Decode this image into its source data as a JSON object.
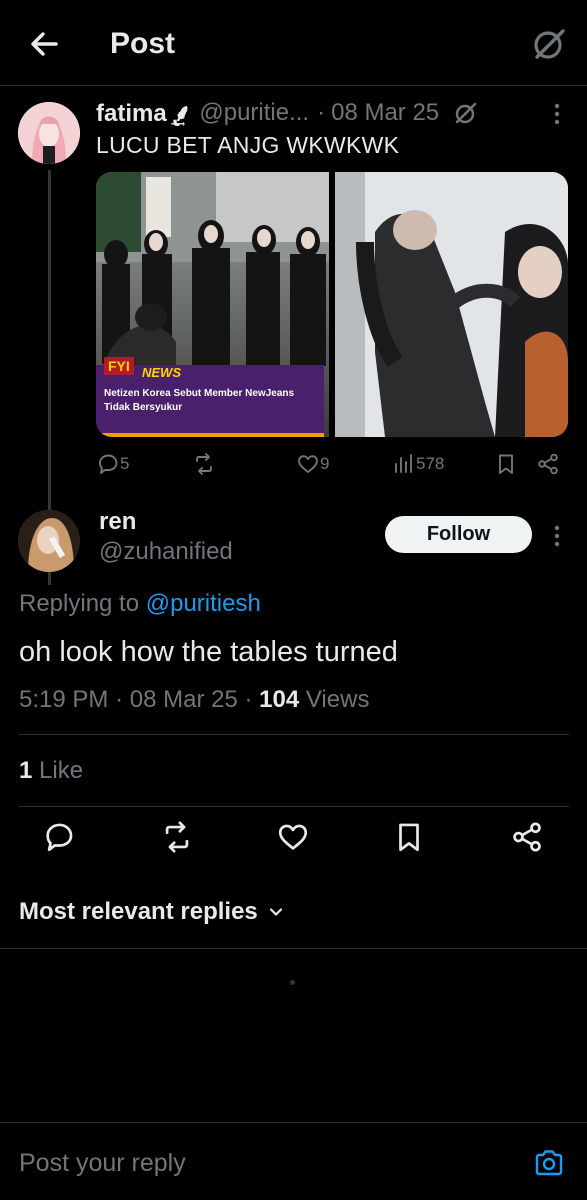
{
  "header": {
    "title": "Post"
  },
  "quoted_post": {
    "author_name": "fatima ̢͢⸙",
    "handle": "@puritie...",
    "dot": "·",
    "date": "08 Mar 25",
    "text": "LUCU BET ANJG WKWKWK",
    "media": {
      "news_logo": "FYI",
      "news_word": "NEWS",
      "news_caption": "Netizen Korea Sebut Member NewJeans Tidak Bersyukur"
    },
    "actions": {
      "replies": "5",
      "likes": "9",
      "views": "578"
    }
  },
  "reply": {
    "author_name": "ren",
    "handle": "@zuhanified",
    "follow_label": "Follow",
    "replying_prefix": "Replying to",
    "replying_mention": "@puritiesh",
    "text": "oh look how the tables turned",
    "time": "5:19 PM",
    "sep1": "·",
    "date": "08 Mar 25",
    "sep2": "·",
    "views_count": "104",
    "views_label": "Views",
    "likes_count": "1",
    "likes_label": "Like"
  },
  "sort": {
    "label": "Most relevant replies"
  },
  "composer": {
    "placeholder": "Post your reply"
  },
  "colors": {
    "accent": "#1d9bf0",
    "background": "#000000",
    "muted": "#71767b",
    "text": "#e7e9ea"
  }
}
